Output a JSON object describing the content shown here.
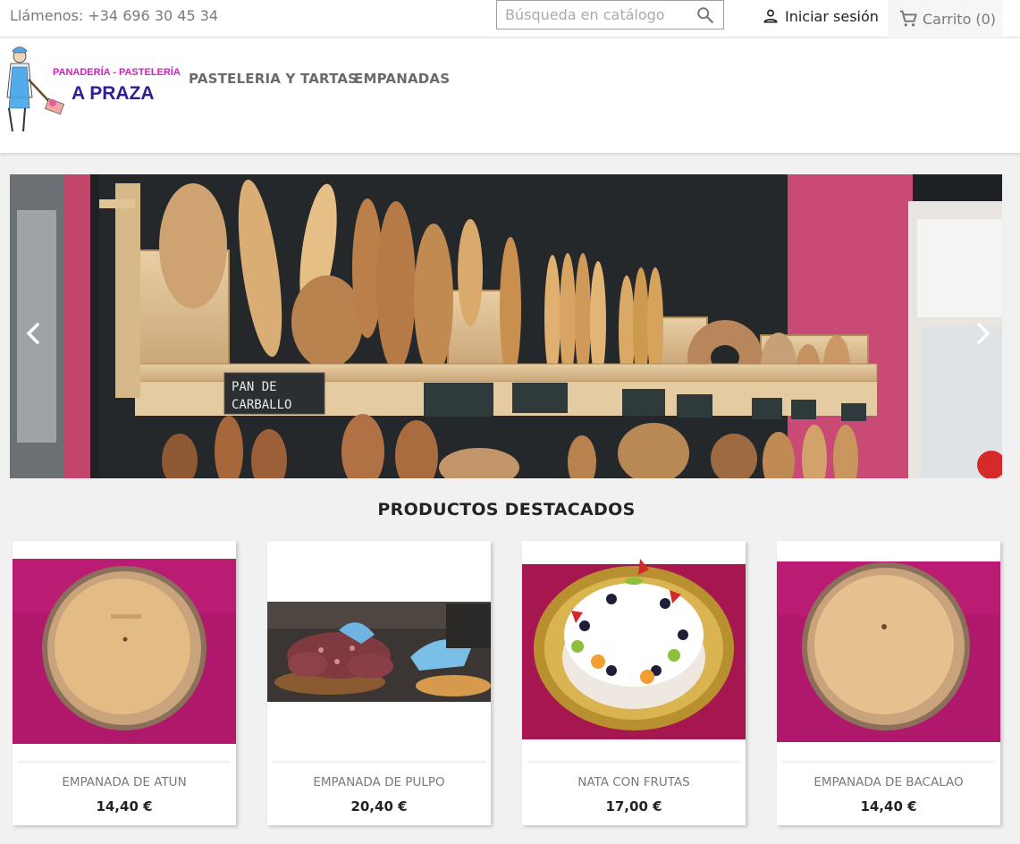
{
  "topbar": {
    "phone": "Llámenos: +34 696 30 45 34",
    "search_placeholder": "Búsqueda en catálogo",
    "search_icon": "search-icon",
    "login_label": "Iniciar sesión",
    "login_icon": "user-icon",
    "cart_label": "Carrito",
    "cart_count": "(0)",
    "cart_icon": "shopping-cart-icon"
  },
  "header": {
    "logo_line1": "PANADERÍA - PASTELERÍA",
    "logo_line2": "A PRAZA",
    "menu": [
      "PASTELERIA Y TARTAS",
      "EMPANADAS"
    ]
  },
  "slider": {
    "image": "bakery bread shelves",
    "chalk_label": "PAN DE CARBALLO",
    "prev_icon": "chevron-left-icon",
    "next_icon": "chevron-right-icon"
  },
  "featured": {
    "title": "PRODUCTOS DESTACADOS",
    "products": [
      {
        "name": "EMPANADA DE ATUN",
        "price": "14,40 €"
      },
      {
        "name": "EMPANADA DE PULPO",
        "price": "20,40 €"
      },
      {
        "name": "NATA CON FRUTAS",
        "price": "17,00 €"
      },
      {
        "name": "EMPANADA DE BACALAO",
        "price": "14,40 €"
      }
    ]
  },
  "colors": {
    "brand_pink": "#d21fc0",
    "brand_blue": "#2d1f95",
    "wall_pink": "#c9456b",
    "product_bg": "#b0186c"
  }
}
